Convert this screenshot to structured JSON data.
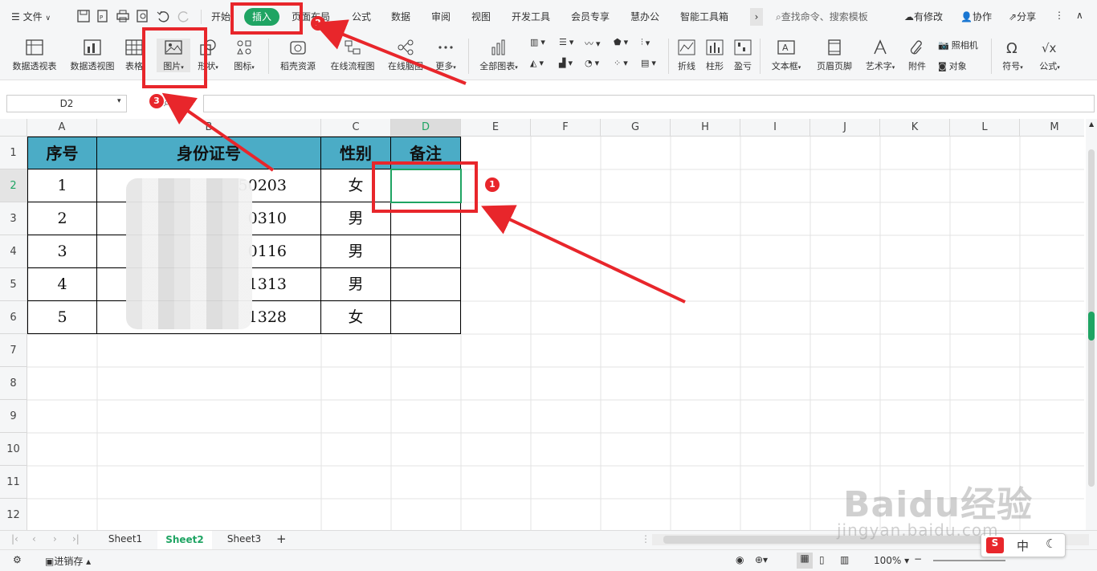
{
  "menubar": {
    "file_label": "文件",
    "tabs": [
      "开始",
      "插入",
      "页面布局",
      "公式",
      "数据",
      "审阅",
      "视图",
      "开发工具",
      "会员专享",
      "慧办公",
      "智能工具箱"
    ],
    "active_tab": "插入",
    "search_placeholder": "查找命令、搜索模板",
    "has_changes": "有修改",
    "collaborate": "协作",
    "share": "分享"
  },
  "toolbar": {
    "pivot_table": "数据透视表",
    "pivot_chart": "数据透视图",
    "table": "表格",
    "picture": "图片",
    "shape": "形状",
    "icon": "图标",
    "docer": "稻壳资源",
    "flowchart": "在线流程图",
    "mindmap": "在线脑图",
    "more": "更多",
    "all_charts": "全部图表",
    "line": "折线",
    "column": "柱形",
    "winloss": "盈亏",
    "textbox": "文本框",
    "header_footer": "页眉页脚",
    "wordart": "艺术字",
    "attachment": "附件",
    "camera": "照相机",
    "object": "对象",
    "symbol": "符号",
    "formula": "公式"
  },
  "formula_bar": {
    "cell_ref": "D2",
    "fx": "fx"
  },
  "columns": [
    "A",
    "B",
    "C",
    "D",
    "E",
    "F",
    "G",
    "H",
    "I",
    "J",
    "K",
    "L",
    "M"
  ],
  "rows": [
    "1",
    "2",
    "3",
    "4",
    "5",
    "6",
    "7",
    "8",
    "9",
    "10",
    "11",
    "12"
  ],
  "table": {
    "headers": [
      "序号",
      "身份证号",
      "性别",
      "备注"
    ],
    "rows": [
      [
        "1",
        "50203",
        "女",
        ""
      ],
      [
        "2",
        "0310",
        "男",
        ""
      ],
      [
        "3",
        "0116",
        "男",
        ""
      ],
      [
        "4",
        "1313",
        "男",
        ""
      ],
      [
        "5",
        "1328",
        "女",
        ""
      ]
    ]
  },
  "sheets": [
    "Sheet1",
    "Sheet2",
    "Sheet3"
  ],
  "active_sheet": "Sheet2",
  "status": {
    "backup": "进销存",
    "zoom": "100%",
    "ime": "中"
  },
  "annotations": [
    "1",
    "2",
    "3"
  ],
  "watermark": {
    "brand": "Baidu经验",
    "url": "jingyan.baidu.com"
  },
  "colors": {
    "accent": "#1fa463",
    "header_fill": "#4bacc6",
    "annotation": "#e8262b"
  }
}
